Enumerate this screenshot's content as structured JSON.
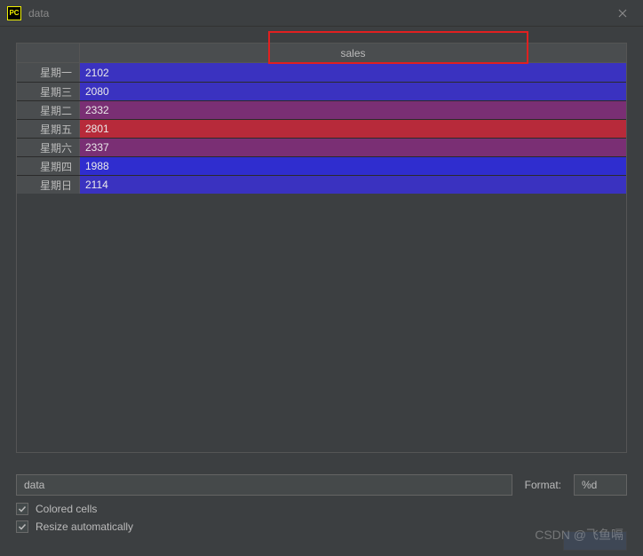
{
  "window": {
    "app_icon_text": "PC",
    "title": "data"
  },
  "table": {
    "header": "sales",
    "rows": [
      {
        "label": "星期一",
        "value": "2102",
        "color": "#3a32c0"
      },
      {
        "label": "星期三",
        "value": "2080",
        "color": "#3a32c0"
      },
      {
        "label": "星期二",
        "value": "2332",
        "color": "#7a2f74"
      },
      {
        "label": "星期五",
        "value": "2801",
        "color": "#b72a3a"
      },
      {
        "label": "星期六",
        "value": "2337",
        "color": "#7a2f74"
      },
      {
        "label": "星期四",
        "value": "1988",
        "color": "#2f2dcf"
      },
      {
        "label": "星期日",
        "value": "2114",
        "color": "#3a32c0"
      }
    ]
  },
  "controls": {
    "data_expression": "data",
    "format_label": "Format:",
    "format_value": "%d",
    "colored_cells_label": "Colored cells",
    "colored_cells_checked": true,
    "resize_auto_label": "Resize automatically",
    "resize_auto_checked": true
  },
  "watermark": "CSDN @飞鱼嗝"
}
